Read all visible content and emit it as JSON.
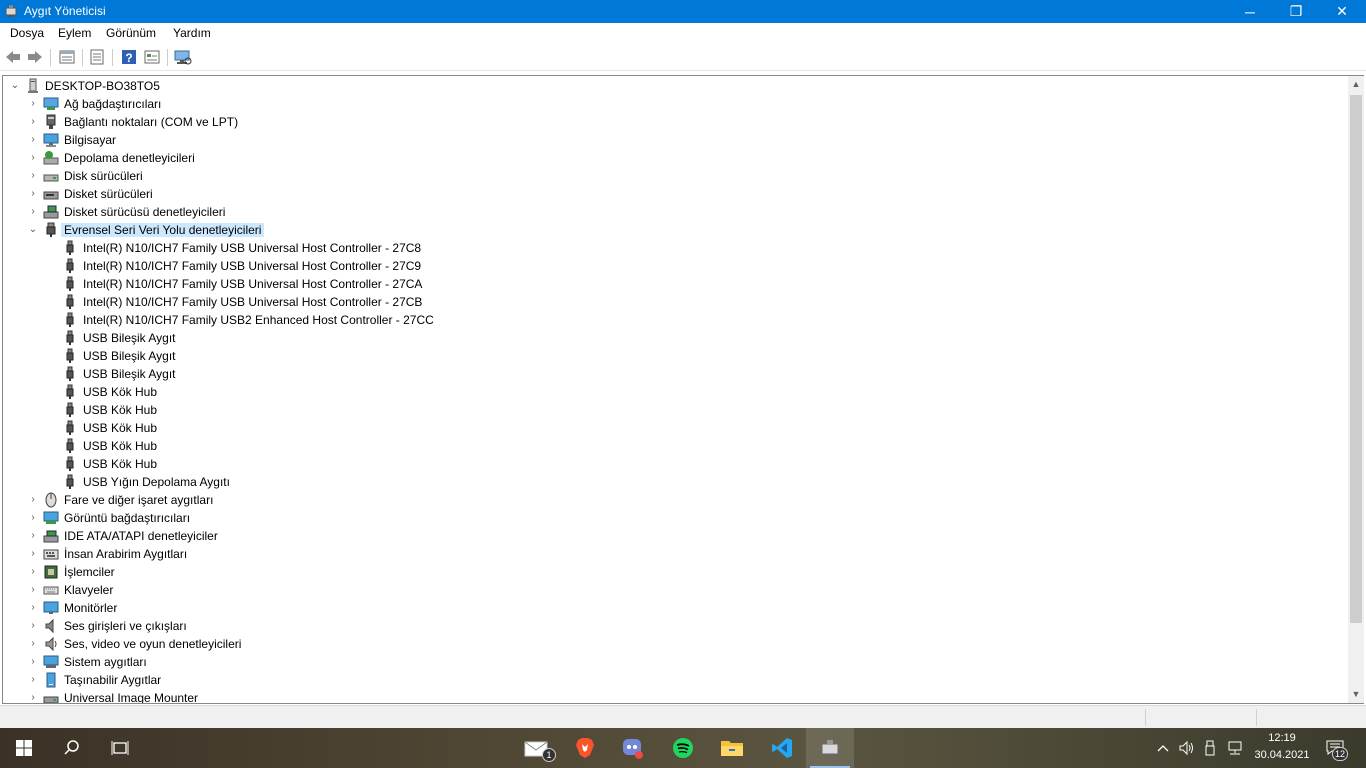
{
  "window": {
    "title": "Aygıt Yöneticisi",
    "controls": {
      "minimize": "─",
      "maximize": "❐",
      "close": "✕"
    }
  },
  "menu": [
    "Dosya",
    "Eylem",
    "Görünüm",
    "Yardım"
  ],
  "toolbar": {
    "buttons": [
      "back-icon",
      "forward-icon",
      "properties-icon",
      "update-driver-icon",
      "help-icon",
      "show-hidden-icon",
      "scan-hardware-icon"
    ]
  },
  "tree": {
    "root": "DESKTOP-BO38TO5",
    "categories_before": [
      {
        "label": "Ağ bağdaştırıcıları",
        "icon": "network-adapter-icon"
      },
      {
        "label": "Bağlantı noktaları (COM ve LPT)",
        "icon": "port-icon"
      },
      {
        "label": "Bilgisayar",
        "icon": "computer-icon"
      },
      {
        "label": "Depolama denetleyicileri",
        "icon": "storage-controller-icon"
      },
      {
        "label": "Disk sürücüleri",
        "icon": "disk-drive-icon"
      },
      {
        "label": "Disket sürücüleri",
        "icon": "floppy-drive-icon"
      },
      {
        "label": "Disket sürücüsü denetleyicileri",
        "icon": "floppy-controller-icon"
      }
    ],
    "expanded": {
      "label": "Evrensel Seri Veri Yolu denetleyicileri",
      "icon": "usb-icon",
      "children": [
        "Intel(R) N10/ICH7 Family USB Universal Host Controller - 27C8",
        "Intel(R) N10/ICH7 Family USB Universal Host Controller - 27C9",
        "Intel(R) N10/ICH7 Family USB Universal Host Controller - 27CA",
        "Intel(R) N10/ICH7 Family USB Universal Host Controller - 27CB",
        "Intel(R) N10/ICH7 Family USB2 Enhanced Host Controller - 27CC",
        "USB Bileşik Aygıt",
        "USB Bileşik Aygıt",
        "USB Bileşik Aygıt",
        "USB Kök Hub",
        "USB Kök Hub",
        "USB Kök Hub",
        "USB Kök Hub",
        "USB Kök Hub",
        "USB Yığın Depolama Aygıtı"
      ]
    },
    "categories_after": [
      {
        "label": "Fare ve diğer işaret aygıtları",
        "icon": "mouse-icon"
      },
      {
        "label": "Görüntü bağdaştırıcıları",
        "icon": "display-adapter-icon"
      },
      {
        "label": "IDE ATA/ATAPI denetleyiciler",
        "icon": "ide-controller-icon"
      },
      {
        "label": "İnsan Arabirim Aygıtları",
        "icon": "hid-icon"
      },
      {
        "label": "İşlemciler",
        "icon": "processor-icon"
      },
      {
        "label": "Klavyeler",
        "icon": "keyboard-icon"
      },
      {
        "label": "Monitörler",
        "icon": "monitor-icon"
      },
      {
        "label": "Ses girişleri ve çıkışları",
        "icon": "audio-io-icon"
      },
      {
        "label": "Ses, video ve oyun denetleyicileri",
        "icon": "sound-video-icon"
      },
      {
        "label": "Sistem aygıtları",
        "icon": "system-devices-icon"
      },
      {
        "label": "Taşınabilir Aygıtlar",
        "icon": "portable-device-icon"
      },
      {
        "label": "Universal Image Mounter",
        "icon": "image-mounter-icon"
      }
    ]
  },
  "taskbar": {
    "apps": [
      "mail-icon",
      "brave-icon",
      "discord-icon",
      "spotify-icon",
      "file-explorer-icon",
      "vscode-icon",
      "device-manager-icon"
    ],
    "mail_badge": "1",
    "clock_time": "12:19",
    "clock_date": "30.04.2021",
    "notification_count": "12"
  },
  "colors": {
    "titlebar": "#0078d7",
    "selection": "#cce8ff",
    "taskbar_active": "#99c4eb"
  }
}
